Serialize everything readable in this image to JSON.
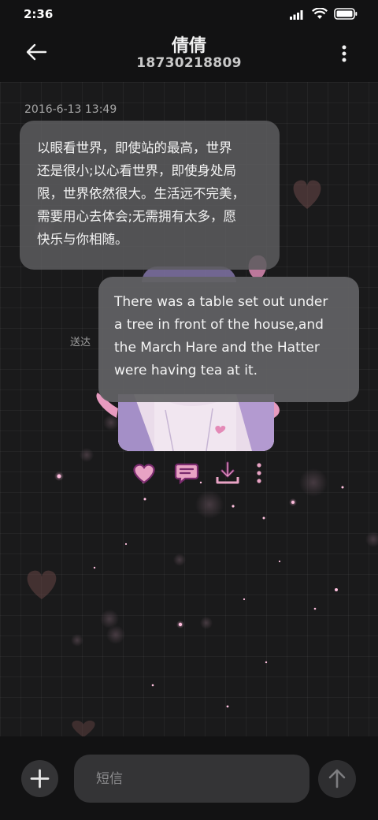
{
  "status_bar": {
    "time": "2:36",
    "icons": [
      "signal-icon",
      "wifi-icon",
      "battery-icon"
    ]
  },
  "header": {
    "contact_name": "倩倩",
    "contact_number": "18730218809",
    "back_icon": "arrow-left-icon",
    "menu_icon": "more-vertical-icon"
  },
  "conversation": {
    "timestamp": "2016-6-13 13:49",
    "incoming_message": {
      "lines": [
        "以眼看世界，即使站的最高，世界",
        "还是很小;以心看世界，即使身处局",
        "限，世界依然很大。生活远不完美，",
        "需要用心去体会;无需拥有太多，愿",
        "快乐与你相随。"
      ]
    },
    "outgoing_message": {
      "lines": [
        "There was a table set out under",
        "a tree in front of the house,and",
        "the March Hare and the Hatter",
        "were having tea at it."
      ]
    },
    "sent_status": "送达"
  },
  "image_actions": [
    "heart-icon",
    "comment-icon",
    "download-icon",
    "more-vertical-icon"
  ],
  "composer": {
    "placeholder": "短信",
    "value": "",
    "add_icon": "plus-icon",
    "send_icon": "arrow-up-icon"
  },
  "colors": {
    "background": "#1a1a1b",
    "bar": "#121213",
    "bubble": "#5c5c5e",
    "accent_pink": "#d98fb6",
    "accent_purple": "#7a2b6e"
  }
}
